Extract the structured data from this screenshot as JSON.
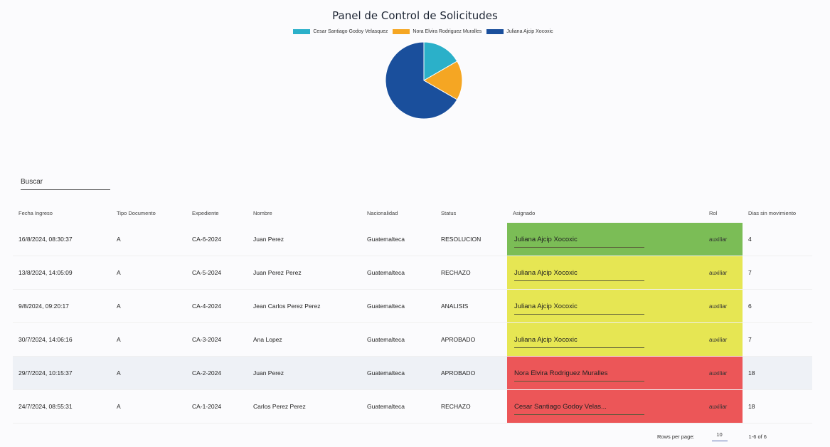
{
  "chart_data": {
    "type": "pie",
    "title": "Panel de Control de Solicitudes",
    "legend_placement": "top",
    "labels": [
      "Cesar Santiago Godoy Velasquez",
      "Nora Elvira Rodriguez Muralles",
      "Juliana Ajcip Xocoxic"
    ],
    "values": [
      1,
      1,
      4
    ],
    "colors": [
      "#2bb0c9",
      "#f5a623",
      "#1a4f9c"
    ]
  },
  "search": {
    "label": "Buscar"
  },
  "table": {
    "headers": [
      "Fecha Ingreso",
      "Tipo Documento",
      "Expediente",
      "Nombre",
      "Nacionalidad",
      "Status",
      "Asignado",
      "Rol",
      "Dias sin movimiento"
    ],
    "rows": [
      {
        "fecha": "16/8/2024, 08:30:37",
        "tipo": "A",
        "expediente": "CA-6-2024",
        "nombre": "Juan Perez",
        "nacionalidad": "Guatemalteca",
        "status": "RESOLUCION",
        "asignado": "Juliana Ajcip Xocoxic",
        "rol": "auxiliar",
        "dias": "4",
        "color": "green"
      },
      {
        "fecha": "13/8/2024, 14:05:09",
        "tipo": "A",
        "expediente": "CA-5-2024",
        "nombre": "Juan Perez Perez",
        "nacionalidad": "Guatemalteca",
        "status": "RECHAZO",
        "asignado": "Juliana Ajcip Xocoxic",
        "rol": "auxiliar",
        "dias": "7",
        "color": "yellow"
      },
      {
        "fecha": "9/8/2024, 09:20:17",
        "tipo": "A",
        "expediente": "CA-4-2024",
        "nombre": "Jean Carlos Perez Perez",
        "nacionalidad": "Guatemalteca",
        "status": "ANALISIS",
        "asignado": "Juliana Ajcip Xocoxic",
        "rol": "auxiliar",
        "dias": "6",
        "color": "yellow"
      },
      {
        "fecha": "30/7/2024, 14:06:16",
        "tipo": "A",
        "expediente": "CA-3-2024",
        "nombre": "Ana Lopez",
        "nacionalidad": "Guatemalteca",
        "status": "APROBADO",
        "asignado": "Juliana Ajcip Xocoxic",
        "rol": "auxiliar",
        "dias": "7",
        "color": "yellow"
      },
      {
        "fecha": "29/7/2024, 10:15:37",
        "tipo": "A",
        "expediente": "CA-2-2024",
        "nombre": "Juan Perez",
        "nacionalidad": "Guatemalteca",
        "status": "APROBADO",
        "asignado": "Nora Elvira Rodriguez Muralles",
        "rol": "auxiliar",
        "dias": "18",
        "color": "red"
      },
      {
        "fecha": "24/7/2024, 08:55:31",
        "tipo": "A",
        "expediente": "CA-1-2024",
        "nombre": "Carlos Perez Perez",
        "nacionalidad": "Guatemalteca",
        "status": "RECHAZO",
        "asignado": "Cesar Santiago Godoy Velas...",
        "rol": "auxiliar",
        "dias": "18",
        "color": "red"
      }
    ]
  },
  "pagination": {
    "rows_label": "Rows per page:",
    "rows_value": "10",
    "range": "1-6 of 6"
  }
}
